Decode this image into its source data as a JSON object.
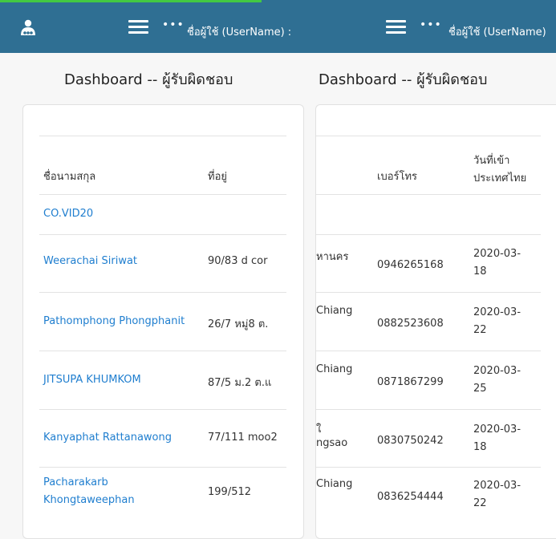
{
  "header": {
    "username_label_left": "ชื่อผู้ใช้ (UserName) :",
    "username_label_right": "ชื่อผู้ใช้ (UserName)",
    "dots": "•••"
  },
  "left_panel": {
    "title": "Dashboard -- ผู้รับผิดชอบ",
    "columns": [
      "ชื่อนามสกุล",
      "ที่อยู่"
    ],
    "group_label": "CO.VID20",
    "rows": [
      {
        "name": "Weerachai Siriwat",
        "address": "90/83 d cor"
      },
      {
        "name": "Pathomphong Phongphanit",
        "address": "26/7 หมู่8 ต."
      },
      {
        "name": "JITSUPA KHUMKOM",
        "address": "87/5 ม.2 ต.แ"
      },
      {
        "name": "Kanyaphat Rattanawong",
        "address": "77/111 moo2"
      },
      {
        "name_line1": "Pacharakarb",
        "name_line2": "Khongtaweephan",
        "address": "199/512"
      }
    ]
  },
  "right_panel": {
    "title": "Dashboard -- ผู้รับผิดชอบ",
    "columns": [
      "เบอร์โทร",
      "วันที่เข้า",
      "ประเทศไทย"
    ],
    "rows": [
      {
        "city": "หานคร",
        "phone": "0946265168",
        "date_line1": "2020-03-",
        "date_line2": "18"
      },
      {
        "city": "Chiang",
        "phone": "0882523608",
        "date_line1": "2020-03-",
        "date_line2": "22"
      },
      {
        "city": "Chiang",
        "phone": "0871867299",
        "date_line1": "2020-03-",
        "date_line2": "25"
      },
      {
        "city_line1": "ใ",
        "city_line2": "ngsao",
        "phone": "0830750242",
        "date_line1": "2020-03-",
        "date_line2": "18"
      },
      {
        "city": "Chiang",
        "phone": "0836254444",
        "date_line1": "2020-03-",
        "date_line2": "22"
      }
    ]
  }
}
